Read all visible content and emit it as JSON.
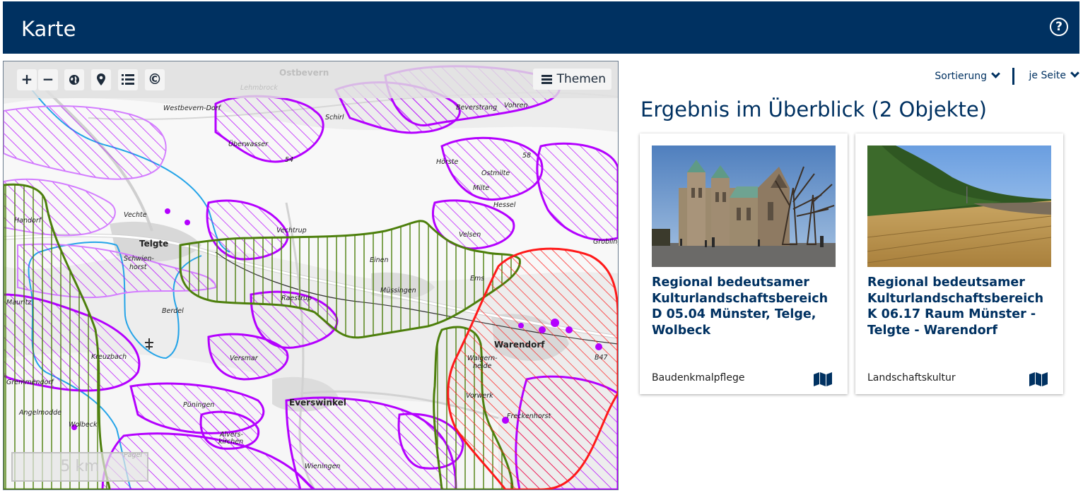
{
  "header": {
    "title": "Karte",
    "help_icon": "help-circle-icon"
  },
  "map": {
    "toolbar": {
      "zoom_in": "+",
      "zoom_out": "−",
      "globe": "globe-icon",
      "marker": "map-marker-icon",
      "list": "list-icon",
      "copyright": "©",
      "themen_label": "Themen"
    },
    "scale_label": "5 km",
    "places": [
      {
        "name": "Ostbevern",
        "kind": "town"
      },
      {
        "name": "Lehmbrock",
        "kind": "small"
      },
      {
        "name": "Westbevern-Dorf",
        "kind": "small"
      },
      {
        "name": "Schirl",
        "kind": "small"
      },
      {
        "name": "Beverstrang",
        "kind": "small"
      },
      {
        "name": "Vohren",
        "kind": "small"
      },
      {
        "name": "Überwasser",
        "kind": "small"
      },
      {
        "name": "Hörste",
        "kind": "small"
      },
      {
        "name": "Ostmilte",
        "kind": "small"
      },
      {
        "name": "Milte",
        "kind": "small"
      },
      {
        "name": "Hessel",
        "kind": "small"
      },
      {
        "name": "Vechtrup",
        "kind": "small"
      },
      {
        "name": "Vechte",
        "kind": "small"
      },
      {
        "name": "Handorf",
        "kind": "small"
      },
      {
        "name": "Telgte",
        "kind": "town"
      },
      {
        "name": "Schwien-",
        "kind": "small"
      },
      {
        "name": "horst",
        "kind": "small"
      },
      {
        "name": "Velsen",
        "kind": "small"
      },
      {
        "name": "Einen",
        "kind": "small"
      },
      {
        "name": "Groblingen",
        "kind": "small"
      },
      {
        "name": "Müssingen",
        "kind": "small"
      },
      {
        "name": "Raestrup",
        "kind": "small"
      },
      {
        "name": "Mauritz",
        "kind": "small"
      },
      {
        "name": "Berdel",
        "kind": "small"
      },
      {
        "name": "Warendorf",
        "kind": "town"
      },
      {
        "name": "Freckenhorst",
        "kind": "small"
      },
      {
        "name": "Walgern-",
        "kind": "small"
      },
      {
        "name": "heide",
        "kind": "small"
      },
      {
        "name": "Vorwerk",
        "kind": "small"
      },
      {
        "name": "Versmar",
        "kind": "small"
      },
      {
        "name": "Everswinkel",
        "kind": "town"
      },
      {
        "name": "Püningen",
        "kind": "small"
      },
      {
        "name": "Alvers-",
        "kind": "small"
      },
      {
        "name": "kirchen",
        "kind": "small"
      },
      {
        "name": "Wolbeck",
        "kind": "small"
      },
      {
        "name": "Angelmodde",
        "kind": "small"
      },
      {
        "name": "Gremmendorf",
        "kind": "small"
      },
      {
        "name": "Kreuzbach",
        "kind": "small"
      },
      {
        "name": "Wieningen",
        "kind": "small"
      },
      {
        "name": "54",
        "kind": "small"
      },
      {
        "name": "58",
        "kind": "small"
      },
      {
        "name": "Ems",
        "kind": "small"
      },
      {
        "name": "Pagel",
        "kind": "small"
      },
      {
        "name": "B47",
        "kind": "small"
      }
    ]
  },
  "controls": {
    "sort_label": "Sortierung",
    "per_page_label": "je Seite"
  },
  "results": {
    "title": "Ergebnis im Überblick (2 Objekte)",
    "cards": [
      {
        "title": "Regional bedeutsamer Kulturlandschaftsbereich D 05.04 Münster, Telge, Wolbeck",
        "category": "Baudenkmalpflege",
        "image": "cathedral-photo",
        "icon": "map-icon"
      },
      {
        "title": "Regional bedeutsamer Kulturlandschaftsbereich K 06.17 Raum Münster - Telgte - Warendorf",
        "category": "Landschaftskultur",
        "image": "field-landscape-photo",
        "icon": "map-icon"
      }
    ]
  },
  "colors": {
    "header_bg": "#003161",
    "accent": "#003161",
    "purple_area": "#b400ff",
    "green_area": "#4d7f0c",
    "red_area": "#ff1a1a",
    "water": "#25a4e8"
  }
}
